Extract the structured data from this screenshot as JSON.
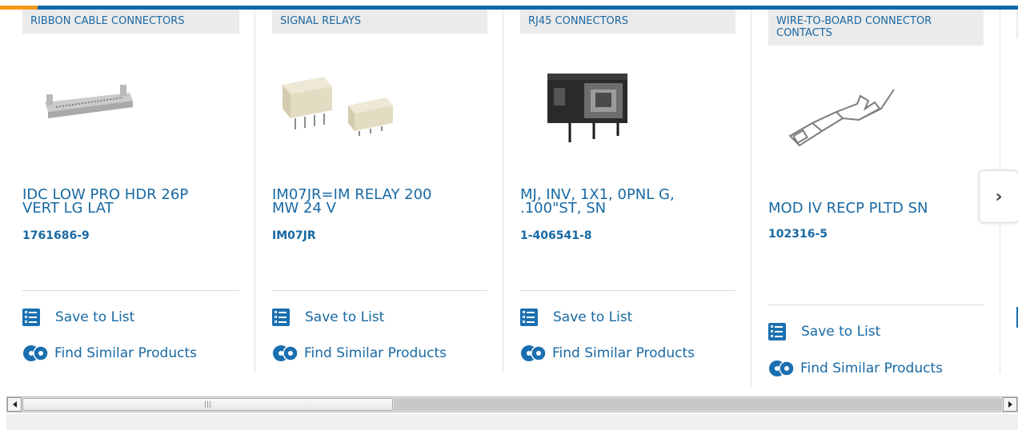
{
  "colors": {
    "brand_blue": "#1169a6",
    "accent_orange": "#f59a1b",
    "link_blue": "#1869a4"
  },
  "cards": [
    {
      "category": "RIBBON CABLE CONNECTORS",
      "name": "IDC LOW PRO HDR 26P\nVERT LG LAT",
      "part_number": "1761686-9",
      "save_label": "Save to List",
      "similar_label": "Find Similar Products"
    },
    {
      "category": "SIGNAL RELAYS",
      "name": "IM07JR=IM RELAY 200\nMW 24 V",
      "part_number": "IM07JR",
      "save_label": "Save to List",
      "similar_label": "Find Similar Products"
    },
    {
      "category": "RJ45 CONNECTORS",
      "name": "MJ, INV, 1X1, 0PNL G,\n.100\"ST, SN",
      "part_number": "1-406541-8",
      "save_label": "Save to List",
      "similar_label": "Find Similar Products"
    },
    {
      "category": "WIRE-TO-BOARD CONNECTOR\nCONTACTS",
      "name": "MOD IV RECP PLTD SN",
      "part_number": "102316-5",
      "save_label": "Save to List",
      "similar_label": "Find Similar Products"
    }
  ],
  "carousel": {
    "next_icon": "chevron-right-icon"
  }
}
